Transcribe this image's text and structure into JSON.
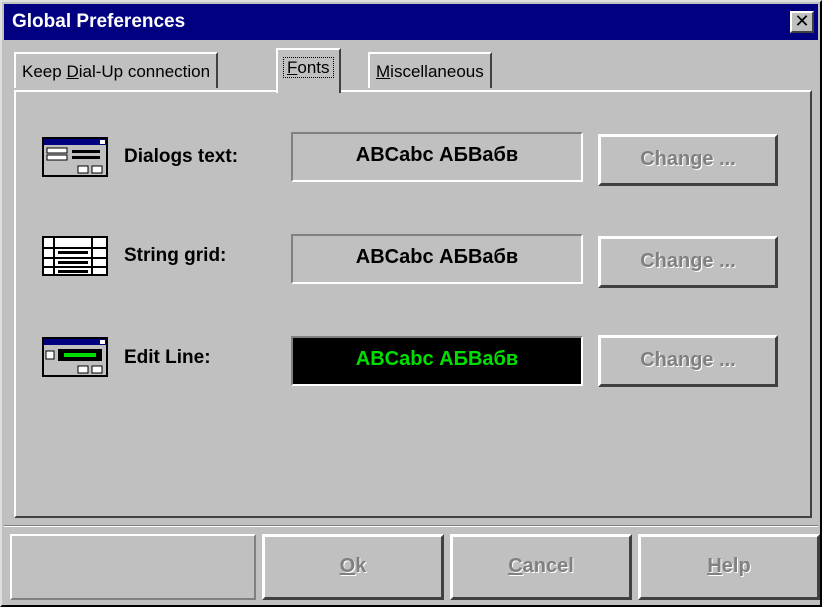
{
  "window": {
    "title": "Global Preferences",
    "close_glyph": "✕"
  },
  "tabs": [
    {
      "pre": "Keep ",
      "acc": "D",
      "post": "ial-Up connection",
      "active": false
    },
    {
      "pre": "",
      "acc": "F",
      "post": "onts",
      "active": true
    },
    {
      "pre": "",
      "acc": "M",
      "post": "iscellaneous",
      "active": false
    }
  ],
  "rows": [
    {
      "label": "Dialogs text:",
      "sample": "ABCabc АБВабв",
      "button": "Change ...",
      "icon": "dialog-text-icon"
    },
    {
      "label": "String grid:",
      "sample": "ABCabc АБВабв",
      "button": "Change ...",
      "icon": "string-grid-icon"
    },
    {
      "label": "Edit Line:",
      "sample": "ABCabc АБВабв",
      "button": "Change ...",
      "icon": "edit-line-icon",
      "sample_bg": "#000000",
      "sample_fg": "#00e000"
    }
  ],
  "footer": {
    "ok": {
      "acc": "O",
      "post": "k"
    },
    "cancel": {
      "acc": "C",
      "post": "ancel"
    },
    "help": {
      "acc": "H",
      "post": "elp"
    }
  },
  "colors": {
    "titlebar": "#000080",
    "face": "#c0c0c0"
  }
}
